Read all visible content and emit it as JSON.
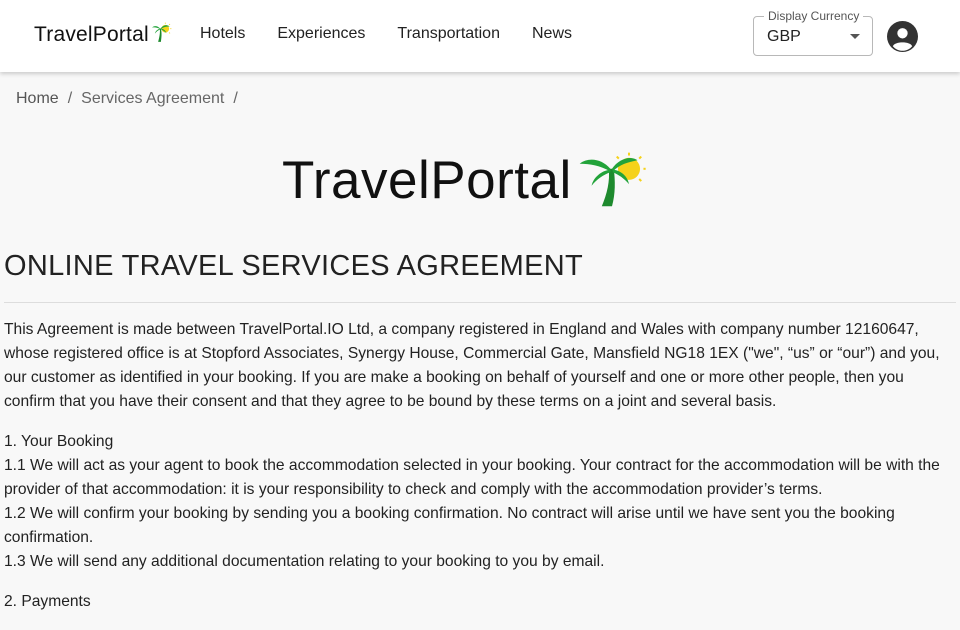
{
  "header": {
    "brand": "TravelPortal",
    "nav": [
      "Hotels",
      "Experiences",
      "Transportation",
      "News"
    ],
    "currency": {
      "label": "Display Currency",
      "value": "GBP"
    }
  },
  "breadcrumb": {
    "home": "Home",
    "separator": "/",
    "current": "Services Agreement",
    "trailing_separator": "/"
  },
  "hero": {
    "logo_text": "TravelPortal"
  },
  "page": {
    "title": "ONLINE TRAVEL SERVICES AGREEMENT",
    "intro": "This Agreement is made between TravelPortal.IO Ltd, a company registered in England and Wales with company number 12160647, whose registered office is at Stopford Associates, Synergy House, Commercial Gate, Mansfield NG18 1EX (\"we\", “us” or “our”) and you, our customer as identified in your booking. If you are make a booking on behalf of yourself and one or more other people, then you confirm that you have their consent and that they agree to be bound by these terms on a joint and several basis.",
    "sections": [
      {
        "heading": "1. Your Booking",
        "clauses": [
          "1.1 We will act as your agent to book the accommodation selected in your booking. Your contract for the accommodation will be with the provider of that accommodation: it is your responsibility to check and comply with the accommodation provider’s terms.",
          "1.2 We will confirm your booking by sending you a booking confirmation. No contract will arise until we have sent you the booking confirmation.",
          "1.3 We will send any additional documentation relating to your booking to you by email."
        ]
      },
      {
        "heading": "2. Payments",
        "clauses": []
      }
    ]
  },
  "colors": {
    "palm_trunk": "#1e8a2e",
    "palm_leaves": "#22a33a",
    "sun": "#f5d21a"
  }
}
